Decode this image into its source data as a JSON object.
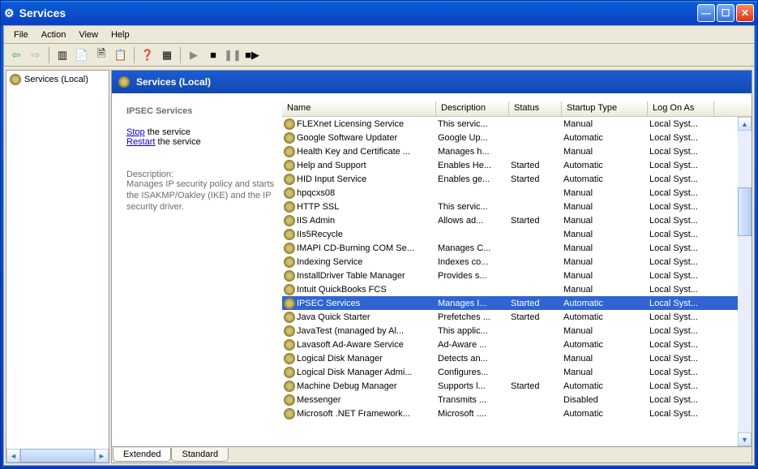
{
  "window": {
    "title": "Services"
  },
  "menu": {
    "file": "File",
    "action": "Action",
    "view": "View",
    "help": "Help"
  },
  "tree": {
    "root": "Services (Local)"
  },
  "header": {
    "title": "Services (Local)"
  },
  "detail": {
    "service_name": "IPSEC Services",
    "stop_link": "Stop",
    "stop_suffix": " the service",
    "restart_link": "Restart",
    "restart_suffix": " the service",
    "desc_label": "Description:",
    "desc_text": "Manages IP security policy and starts the ISAKMP/Oakley (IKE) and the IP security driver."
  },
  "columns": {
    "name": "Name",
    "description": "Description",
    "status": "Status",
    "startup": "Startup Type",
    "logon": "Log On As"
  },
  "services": [
    {
      "name": "FLEXnet Licensing Service",
      "desc": "This servic...",
      "status": "",
      "startup": "Manual",
      "logon": "Local Syst..."
    },
    {
      "name": "Google Software Updater",
      "desc": "Google Up...",
      "status": "",
      "startup": "Automatic",
      "logon": "Local Syst..."
    },
    {
      "name": "Health Key and Certificate ...",
      "desc": "Manages h...",
      "status": "",
      "startup": "Manual",
      "logon": "Local Syst..."
    },
    {
      "name": "Help and Support",
      "desc": "Enables He...",
      "status": "Started",
      "startup": "Automatic",
      "logon": "Local Syst..."
    },
    {
      "name": "HID Input Service",
      "desc": "Enables ge...",
      "status": "Started",
      "startup": "Automatic",
      "logon": "Local Syst..."
    },
    {
      "name": "hpqcxs08",
      "desc": "",
      "status": "",
      "startup": "Manual",
      "logon": "Local Syst..."
    },
    {
      "name": "HTTP SSL",
      "desc": "This servic...",
      "status": "",
      "startup": "Manual",
      "logon": "Local Syst..."
    },
    {
      "name": "IIS Admin",
      "desc": "Allows ad...",
      "status": "Started",
      "startup": "Manual",
      "logon": "Local Syst..."
    },
    {
      "name": "IIs5Recycle",
      "desc": "",
      "status": "",
      "startup": "Manual",
      "logon": "Local Syst..."
    },
    {
      "name": "IMAPI CD-Burning COM Se...",
      "desc": "Manages C...",
      "status": "",
      "startup": "Manual",
      "logon": "Local Syst..."
    },
    {
      "name": "Indexing Service",
      "desc": "Indexes co...",
      "status": "",
      "startup": "Manual",
      "logon": "Local Syst..."
    },
    {
      "name": "InstallDriver Table Manager",
      "desc": "Provides s...",
      "status": "",
      "startup": "Manual",
      "logon": "Local Syst..."
    },
    {
      "name": "Intuit QuickBooks FCS",
      "desc": "",
      "status": "",
      "startup": "Manual",
      "logon": "Local Syst..."
    },
    {
      "name": "IPSEC Services",
      "desc": "Manages I...",
      "status": "Started",
      "startup": "Automatic",
      "logon": "Local Syst...",
      "selected": true
    },
    {
      "name": "Java Quick Starter",
      "desc": "Prefetches ...",
      "status": "Started",
      "startup": "Automatic",
      "logon": "Local Syst..."
    },
    {
      "name": "JavaTest (managed by Al...",
      "desc": "This applic...",
      "status": "",
      "startup": "Manual",
      "logon": "Local Syst..."
    },
    {
      "name": "Lavasoft Ad-Aware Service",
      "desc": "Ad-Aware ...",
      "status": "",
      "startup": "Automatic",
      "logon": "Local Syst..."
    },
    {
      "name": "Logical Disk Manager",
      "desc": "Detects an...",
      "status": "",
      "startup": "Manual",
      "logon": "Local Syst..."
    },
    {
      "name": "Logical Disk Manager Admi...",
      "desc": "Configures...",
      "status": "",
      "startup": "Manual",
      "logon": "Local Syst..."
    },
    {
      "name": "Machine Debug Manager",
      "desc": "Supports l...",
      "status": "Started",
      "startup": "Automatic",
      "logon": "Local Syst..."
    },
    {
      "name": "Messenger",
      "desc": "Transmits ...",
      "status": "",
      "startup": "Disabled",
      "logon": "Local Syst..."
    },
    {
      "name": "Microsoft .NET Framework...",
      "desc": "Microsoft ....",
      "status": "",
      "startup": "Automatic",
      "logon": "Local Syst..."
    }
  ],
  "tabs": {
    "extended": "Extended",
    "standard": "Standard"
  }
}
